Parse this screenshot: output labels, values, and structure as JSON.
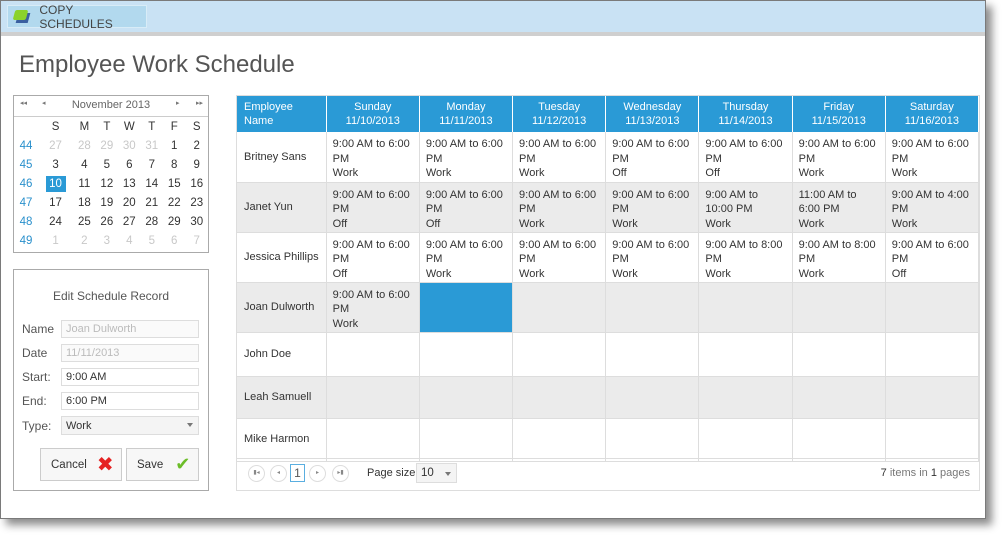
{
  "toolbar": {
    "copy_label": "COPY SCHEDULES"
  },
  "page_title": "Employee Work Schedule",
  "calendar": {
    "month_label": "November 2013",
    "nav": {
      "prev_year": "◂◂",
      "prev": "◂",
      "next": "▸",
      "next_year": "▸▸"
    },
    "day_headers": [
      "S",
      "M",
      "T",
      "W",
      "T",
      "F",
      "S"
    ],
    "weeks": [
      {
        "week": "44",
        "days": [
          {
            "d": "27",
            "other": true
          },
          {
            "d": "28",
            "other": true
          },
          {
            "d": "29",
            "other": true
          },
          {
            "d": "30",
            "other": true
          },
          {
            "d": "31",
            "other": true
          },
          {
            "d": "1"
          },
          {
            "d": "2"
          }
        ]
      },
      {
        "week": "45",
        "days": [
          {
            "d": "3"
          },
          {
            "d": "4"
          },
          {
            "d": "5"
          },
          {
            "d": "6"
          },
          {
            "d": "7"
          },
          {
            "d": "8"
          },
          {
            "d": "9"
          }
        ]
      },
      {
        "week": "46",
        "days": [
          {
            "d": "10",
            "selected": true
          },
          {
            "d": "11"
          },
          {
            "d": "12"
          },
          {
            "d": "13"
          },
          {
            "d": "14"
          },
          {
            "d": "15"
          },
          {
            "d": "16"
          }
        ]
      },
      {
        "week": "47",
        "days": [
          {
            "d": "17"
          },
          {
            "d": "18"
          },
          {
            "d": "19"
          },
          {
            "d": "20"
          },
          {
            "d": "21"
          },
          {
            "d": "22"
          },
          {
            "d": "23"
          }
        ]
      },
      {
        "week": "48",
        "days": [
          {
            "d": "24"
          },
          {
            "d": "25"
          },
          {
            "d": "26"
          },
          {
            "d": "27"
          },
          {
            "d": "28"
          },
          {
            "d": "29"
          },
          {
            "d": "30"
          }
        ]
      },
      {
        "week": "49",
        "days": [
          {
            "d": "1",
            "other": true
          },
          {
            "d": "2",
            "other": true
          },
          {
            "d": "3",
            "other": true
          },
          {
            "d": "4",
            "other": true
          },
          {
            "d": "5",
            "other": true
          },
          {
            "d": "6",
            "other": true
          },
          {
            "d": "7",
            "other": true
          }
        ]
      }
    ]
  },
  "edit": {
    "title": "Edit Schedule Record",
    "name_label": "Name",
    "name_value": "Joan Dulworth",
    "date_label": "Date",
    "date_value": "11/11/2013",
    "start_label": "Start:",
    "start_value": "9:00 AM",
    "end_label": "End:",
    "end_value": "6:00 PM",
    "type_label": "Type:",
    "type_value": "Work",
    "cancel_label": "Cancel",
    "save_label": "Save"
  },
  "grid": {
    "columns": [
      {
        "line1": "Employee",
        "line2": "Name"
      },
      {
        "line1": "Sunday",
        "line2": "11/10/2013"
      },
      {
        "line1": "Monday",
        "line2": "11/11/2013"
      },
      {
        "line1": "Tuesday",
        "line2": "11/12/2013"
      },
      {
        "line1": "Wednesday",
        "line2": "11/13/2013"
      },
      {
        "line1": "Thursday",
        "line2": "11/14/2013"
      },
      {
        "line1": "Friday",
        "line2": "11/15/2013"
      },
      {
        "line1": "Saturday",
        "line2": "11/16/2013"
      }
    ],
    "rows": [
      {
        "name": "Britney Sans",
        "cells": [
          {
            "time": "9:00 AM to 6:00 PM",
            "type": "Work"
          },
          {
            "time": "9:00 AM to 6:00 PM",
            "type": "Work"
          },
          {
            "time": "9:00 AM to 6:00 PM",
            "type": "Work"
          },
          {
            "time": "9:00 AM to 6:00 PM",
            "type": "Off"
          },
          {
            "time": "9:00 AM to 6:00 PM",
            "type": "Off"
          },
          {
            "time": "9:00 AM to 6:00 PM",
            "type": "Work"
          },
          {
            "time": "9:00 AM to 6:00 PM",
            "type": "Work"
          }
        ]
      },
      {
        "name": "Janet Yun",
        "cells": [
          {
            "time": "9:00 AM to 6:00 PM",
            "type": "Off"
          },
          {
            "time": "9:00 AM to 6:00 PM",
            "type": "Off"
          },
          {
            "time": "9:00 AM to 6:00 PM",
            "type": "Work"
          },
          {
            "time": "9:00 AM to 6:00 PM",
            "type": "Work"
          },
          {
            "time": "9:00 AM to 10:00 PM",
            "type": "Work"
          },
          {
            "time": "11:00 AM to 6:00 PM",
            "type": "Work"
          },
          {
            "time": "9:00 AM to 4:00 PM",
            "type": "Work"
          }
        ]
      },
      {
        "name": "Jessica Phillips",
        "cells": [
          {
            "time": "9:00 AM to 6:00 PM",
            "type": "Off"
          },
          {
            "time": "9:00 AM to 6:00 PM",
            "type": "Work"
          },
          {
            "time": "9:00 AM to 6:00 PM",
            "type": "Work"
          },
          {
            "time": "9:00 AM to 6:00 PM",
            "type": "Work"
          },
          {
            "time": "9:00 AM to 8:00 PM",
            "type": "Work"
          },
          {
            "time": "9:00 AM to 8:00 PM",
            "type": "Work"
          },
          {
            "time": "9:00 AM to 6:00 PM",
            "type": "Off"
          }
        ]
      },
      {
        "name": "Joan Dulworth",
        "cells": [
          {
            "time": "9:00 AM to 6:00 PM",
            "type": "Work"
          },
          {
            "selected": true
          },
          {},
          {},
          {},
          {},
          {}
        ]
      },
      {
        "name": "John Doe",
        "cells": [
          {},
          {},
          {},
          {},
          {},
          {},
          {}
        ]
      },
      {
        "name": "Leah Samuell",
        "cells": [
          {},
          {},
          {},
          {},
          {},
          {},
          {}
        ]
      },
      {
        "name": "Mike Harmon",
        "cells": [
          {},
          {},
          {},
          {},
          {},
          {},
          {}
        ]
      }
    ],
    "pager": {
      "current_page": "1",
      "page_size_label": "Page size:",
      "page_size_value": "10",
      "items_count": "7",
      "items_text": "items in",
      "pages_count": "1",
      "pages_text": "pages"
    }
  },
  "colors": {
    "accent": "#2a9ad6",
    "toolbar": "#c9e2f4",
    "alt_row": "#ebebeb"
  }
}
